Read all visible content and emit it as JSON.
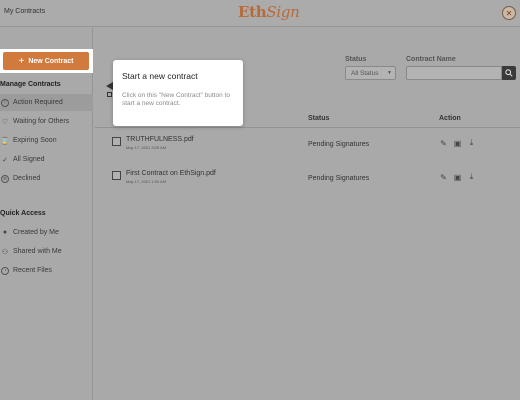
{
  "header": {
    "breadcrumb": "My Contracts",
    "logo_text_a": "Eth",
    "logo_text_b": "Sign",
    "avatar_icon": "user-avatar-icon",
    "avatar_glyph": "✕"
  },
  "sidebar": {
    "new_contract_label": "New Contract",
    "manage_title": "Manage Contracts",
    "manage_items": [
      {
        "label": "Action Required",
        "icon": "alert-circle-icon",
        "active": true
      },
      {
        "label": "Waiting for Others",
        "icon": "heart-icon",
        "active": false
      },
      {
        "label": "Expiring Soon",
        "icon": "clock-icon",
        "active": false
      },
      {
        "label": "All Signed",
        "icon": "all-signed-icon",
        "active": false
      },
      {
        "label": "Declined",
        "icon": "declined-icon",
        "active": false
      }
    ],
    "quick_title": "Quick Access",
    "quick_items": [
      {
        "label": "Created by Me",
        "icon": "person-icon"
      },
      {
        "label": "Shared with Me",
        "icon": "people-icon"
      },
      {
        "label": "Recent Files",
        "icon": "recent-icon"
      }
    ]
  },
  "filters": {
    "status_label": "Status",
    "status_value": "All Status",
    "name_label": "Contract Name",
    "name_value": ""
  },
  "table": {
    "col_status": "Status",
    "col_action": "Action",
    "rows": [
      {
        "name": "TRUTHFULNESS.pdf",
        "date": "May 17, 2021 3:05 AM",
        "status": "Pending Signatures"
      },
      {
        "name": "First Contract on EthSign.pdf",
        "date": "May 17, 2021 1:50 AM",
        "status": "Pending Signatures"
      }
    ]
  },
  "tooltip": {
    "title": "Start a new contract",
    "body": "Click on this \"New Contract\" button to start a new contract."
  },
  "colors": {
    "accent": "#d07a3e",
    "logo": "#b86a36",
    "overlay_bg": "#a9a9a9"
  }
}
